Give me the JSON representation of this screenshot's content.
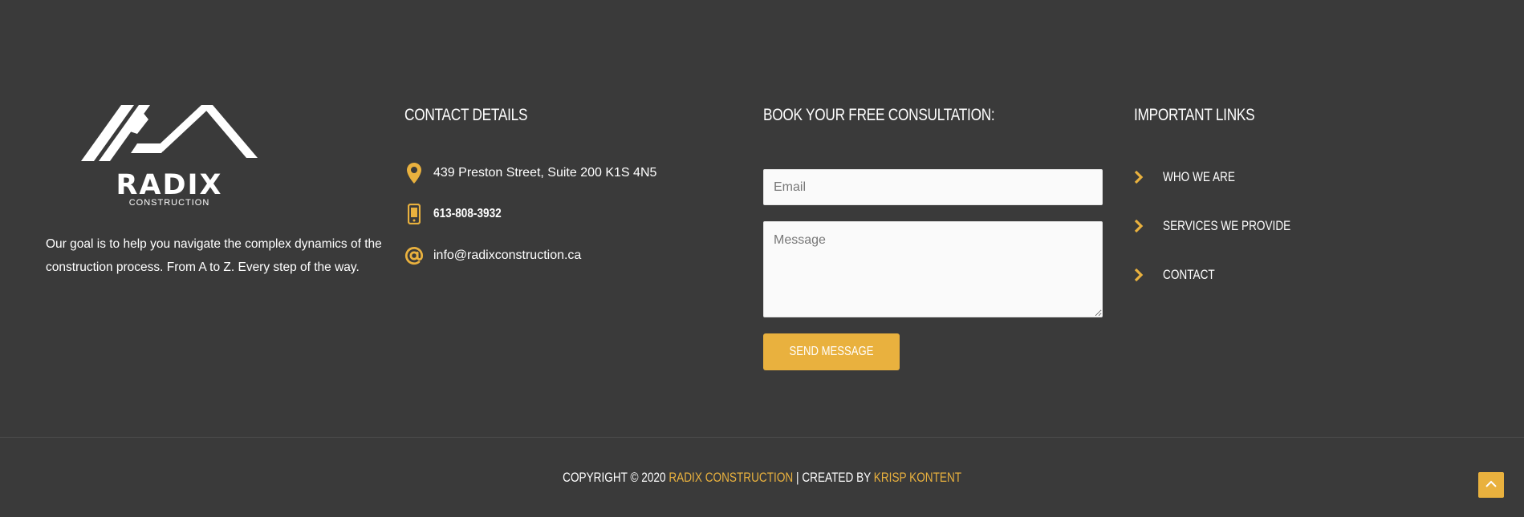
{
  "colors": {
    "background": "#3a3a3a",
    "accent": "#e9b13e",
    "text": "#ffffff",
    "input_bg": "#fafafa"
  },
  "brand": {
    "logo_word": "RADIX",
    "logo_sub": "CONSTRUCTION"
  },
  "about": {
    "text": "Our goal is to help you navigate the complex dynamics of the construction process. From A to Z. Every step of the way."
  },
  "contact": {
    "heading": "CONTACT DETAILS",
    "items": [
      {
        "icon": "map-pin-icon",
        "text": "439 Preston Street, Suite 200 K1S 4N5"
      },
      {
        "icon": "mobile-phone-icon",
        "text": "613-808-3932"
      },
      {
        "icon": "at-sign-icon",
        "text": "info@radixconstruction.ca"
      }
    ]
  },
  "form": {
    "heading": "BOOK YOUR FREE CONSULTATION:",
    "email_placeholder": "Email",
    "message_placeholder": "Message",
    "submit_label": "SEND MESSAGE"
  },
  "links": {
    "heading": "IMPORTANT LINKS",
    "items": [
      {
        "label": "WHO WE ARE",
        "icon": "chevron-right-icon"
      },
      {
        "label": "SERVICES WE PROVIDE",
        "icon": "chevron-right-icon"
      },
      {
        "label": "CONTACT",
        "icon": "chevron-right-icon"
      }
    ]
  },
  "copyright": {
    "prefix": "COPYRIGHT © 2020 ",
    "company": "RADIX CONSTRUCTION",
    "middle": " | CREATED BY ",
    "creator": "KRISP KONTENT"
  },
  "scroll_top": {
    "icon": "chevron-up-icon"
  }
}
